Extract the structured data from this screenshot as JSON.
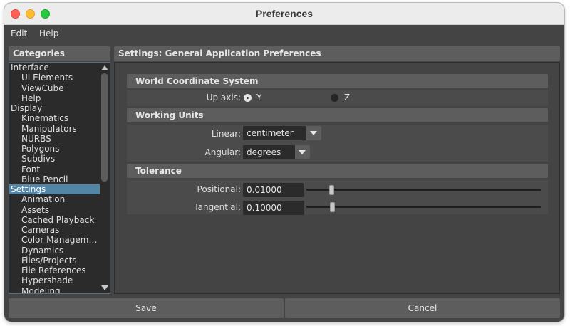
{
  "window": {
    "title": "Preferences"
  },
  "menu": {
    "edit": "Edit",
    "help": "Help"
  },
  "categories": {
    "header": "Categories",
    "items": [
      {
        "label": "Interface",
        "level": 0
      },
      {
        "label": "UI Elements",
        "level": 1
      },
      {
        "label": "ViewCube",
        "level": 1
      },
      {
        "label": "Help",
        "level": 1
      },
      {
        "label": "Display",
        "level": 0
      },
      {
        "label": "Kinematics",
        "level": 1
      },
      {
        "label": "Manipulators",
        "level": 1
      },
      {
        "label": "NURBS",
        "level": 1
      },
      {
        "label": "Polygons",
        "level": 1
      },
      {
        "label": "Subdivs",
        "level": 1
      },
      {
        "label": "Font",
        "level": 1
      },
      {
        "label": "Blue Pencil",
        "level": 1
      },
      {
        "label": "Settings",
        "level": 0,
        "selected": true
      },
      {
        "label": "Animation",
        "level": 1
      },
      {
        "label": "Assets",
        "level": 1
      },
      {
        "label": "Cached Playback",
        "level": 1
      },
      {
        "label": "Cameras",
        "level": 1
      },
      {
        "label": "Color Managem…",
        "level": 1
      },
      {
        "label": "Dynamics",
        "level": 1
      },
      {
        "label": "Files/Projects",
        "level": 1
      },
      {
        "label": "File References",
        "level": 1
      },
      {
        "label": "Hypershade",
        "level": 1
      },
      {
        "label": "Modeling",
        "level": 1
      }
    ]
  },
  "settings": {
    "header": "Settings: General Application Preferences",
    "world": {
      "title": "World Coordinate System",
      "up_axis_label": "Up axis:",
      "option_y": "Y",
      "option_z": "Z",
      "selected": "Y"
    },
    "units": {
      "title": "Working Units",
      "linear_label": "Linear:",
      "linear_value": "centimeter",
      "angular_label": "Angular:",
      "angular_value": "degrees"
    },
    "tolerance": {
      "title": "Tolerance",
      "positional_label": "Positional:",
      "positional_value": "0.01000",
      "tangential_label": "Tangential:",
      "tangential_value": "0.10000"
    }
  },
  "footer": {
    "save": "Save",
    "cancel": "Cancel"
  },
  "colors": {
    "selection": "#5285a6",
    "panel": "#444444",
    "header": "#5d5d5d",
    "field": "#2b2b2b"
  }
}
